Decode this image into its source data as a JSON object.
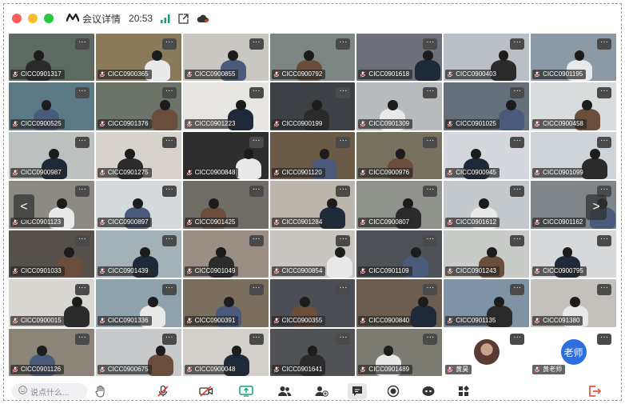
{
  "window": {
    "title": "会议详情",
    "time": "20:53"
  },
  "icons": {
    "signal": "signal-bars-icon",
    "share": "external-link-icon",
    "cloud": "cloud-icon",
    "logo": "meeting-logo-icon"
  },
  "tile_more_label": "···",
  "participants": [
    {
      "name": "CICC0901317",
      "bg": "#5c6a62"
    },
    {
      "name": "CICC0900365",
      "bg": "#8a7a5a"
    },
    {
      "name": "CICC0900855",
      "bg": "#c9c7c2"
    },
    {
      "name": "CICC0900792",
      "bg": "#7e8684"
    },
    {
      "name": "CICC0901618",
      "bg": "#6d7078"
    },
    {
      "name": "CICC0900403",
      "bg": "#b9bfc4"
    },
    {
      "name": "CICC0901195",
      "bg": "#8c9aa5"
    },
    {
      "name": "CICC0900525",
      "bg": "#5b7a86"
    },
    {
      "name": "CICC0901376",
      "bg": "#6c7469"
    },
    {
      "name": "CICC0901223",
      "bg": "#e8e6e3"
    },
    {
      "name": "CICC0900199",
      "bg": "#3d4146"
    },
    {
      "name": "CICC0901309",
      "bg": "#b7bbbe"
    },
    {
      "name": "CICC0901025",
      "bg": "#65707a"
    },
    {
      "name": "CICC0900458",
      "bg": "#d9dcdc"
    },
    {
      "name": "CICC0900987",
      "bg": "#bcc0bf"
    },
    {
      "name": "CICC0901275",
      "bg": "#d7d3cc"
    },
    {
      "name": "CICC0900848",
      "bg": "#2e2e2e"
    },
    {
      "name": "CICC0901120",
      "bg": "#6b5a45"
    },
    {
      "name": "CICC0900976",
      "bg": "#76725d"
    },
    {
      "name": "CICC0900945",
      "bg": "#d4d8dc"
    },
    {
      "name": "CICC0901099",
      "bg": "#cfd4d8"
    },
    {
      "name": "CICC0901123",
      "bg": "#8d8a84"
    },
    {
      "name": "CICC0900897",
      "bg": "#d5d9dc"
    },
    {
      "name": "CICC0901425",
      "bg": "#6f6d66"
    },
    {
      "name": "CICC0901284",
      "bg": "#bdb6ad"
    },
    {
      "name": "CICC0900807",
      "bg": "#8f938c"
    },
    {
      "name": "CICC0901612",
      "bg": "#c4c9cd"
    },
    {
      "name": "CICC0901162",
      "bg": "#80858a"
    },
    {
      "name": "CICC0901033",
      "bg": "#56504a"
    },
    {
      "name": "CICC0901439",
      "bg": "#a4b2b8"
    },
    {
      "name": "CICC0901049",
      "bg": "#9a8f85"
    },
    {
      "name": "CICC0900854",
      "bg": "#c8c5c0"
    },
    {
      "name": "CICC0901109",
      "bg": "#4e5156"
    },
    {
      "name": "CICC0901243",
      "bg": "#c9cbc8"
    },
    {
      "name": "CICC0900795",
      "bg": "#d6d8da"
    },
    {
      "name": "CICC0900015",
      "bg": "#d9d7d2"
    },
    {
      "name": "CICC0901336",
      "bg": "#8fa3ad"
    },
    {
      "name": "CICC0900391",
      "bg": "#7a6f5c"
    },
    {
      "name": "CICC0900355",
      "bg": "#4b4f55"
    },
    {
      "name": "CICC0900840",
      "bg": "#6d5d50"
    },
    {
      "name": "CICC0901135",
      "bg": "#7f93a6"
    },
    {
      "name": "CICC091380",
      "bg": "#c4c1bc"
    },
    {
      "name": "CICC0901126",
      "bg": "#8c857a"
    },
    {
      "name": "CICC0900675",
      "bg": "#c7c9cb"
    },
    {
      "name": "CICC0900048",
      "bg": "#d3d0cb"
    },
    {
      "name": "CICC0901641",
      "bg": "#505255"
    },
    {
      "name": "CICC0901489",
      "bg": "#7c7b72"
    },
    {
      "name": "黄昊",
      "bg": "#ffffff",
      "avatar": "photo"
    },
    {
      "name": "黄老师",
      "bg": "#ffffff",
      "avatar": "老师"
    }
  ],
  "nav": {
    "prev": "<",
    "next": ">"
  },
  "chat": {
    "placeholder": "说点什么..."
  },
  "toolbar_icons": [
    "hand-raise-icon",
    "mic-muted-icon",
    "camera-off-icon",
    "screen-share-icon",
    "participants-icon",
    "invite-icon",
    "chat-icon",
    "record-icon",
    "ai-assistant-icon",
    "apps-icon",
    "leave-icon"
  ],
  "colors": {
    "leave": "#e85a3d",
    "share": "#12a37f"
  }
}
